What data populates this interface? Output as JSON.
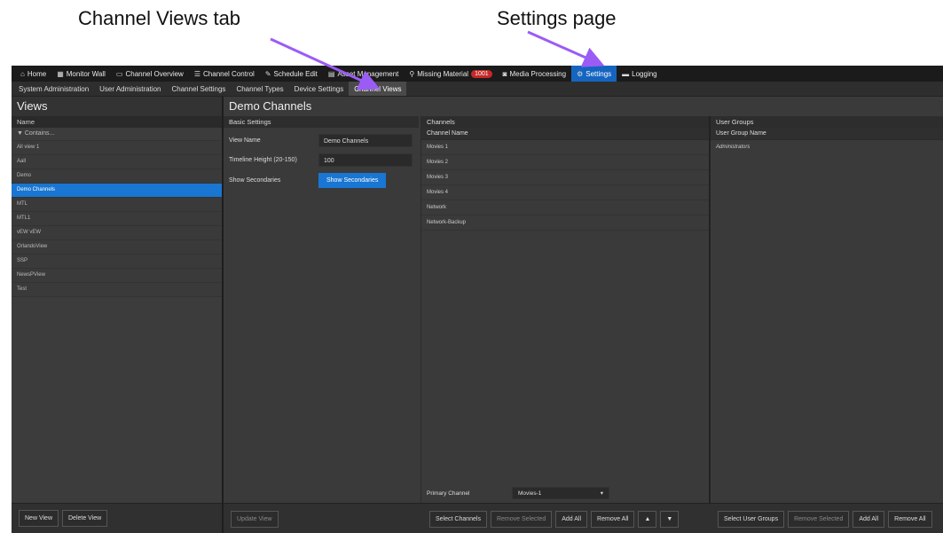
{
  "callouts": {
    "channel_views_tab": "Channel Views tab",
    "settings_page": "Settings page"
  },
  "top_nav": [
    {
      "icon": "home-icon",
      "glyph": "⌂",
      "label": "Home"
    },
    {
      "icon": "monitor-wall-icon",
      "glyph": "▦",
      "label": "Monitor Wall"
    },
    {
      "icon": "channel-overview-icon",
      "glyph": "▭",
      "label": "Channel Overview"
    },
    {
      "icon": "channel-control-icon",
      "glyph": "☰",
      "label": "Channel Control"
    },
    {
      "icon": "schedule-edit-icon",
      "glyph": "✎",
      "label": "Schedule Edit"
    },
    {
      "icon": "asset-management-icon",
      "glyph": "▤",
      "label": "Asset Management"
    },
    {
      "icon": "search-icon",
      "glyph": "⚲",
      "label": "Missing Material",
      "badge": "1001"
    },
    {
      "icon": "media-processing-icon",
      "glyph": "◙",
      "label": "Media Processing"
    },
    {
      "icon": "gear-icon",
      "glyph": "⚙",
      "label": "Settings",
      "active": true
    },
    {
      "icon": "logging-icon",
      "glyph": "▬",
      "label": "Logging"
    }
  ],
  "sub_nav": [
    {
      "label": "System Administration"
    },
    {
      "label": "User Administration"
    },
    {
      "label": "Channel Settings"
    },
    {
      "label": "Channel Types"
    },
    {
      "label": "Device Settings"
    },
    {
      "label": "Channel Views",
      "active": true
    }
  ],
  "views_panel": {
    "title": "Views",
    "column_header": "Name",
    "filter_label": "▼ Contains...",
    "items": [
      "All view 1",
      "Aall",
      "Demo",
      "Demo Channels",
      "MTL",
      "MTL1",
      "vEW vEW",
      "OrlandoView",
      "SSP",
      "NewsPView",
      "Test"
    ],
    "selected_index": 3,
    "new_button": "New View",
    "delete_button": "Delete View"
  },
  "main_panel": {
    "title": "Demo Channels",
    "basic_settings": {
      "header": "Basic Settings",
      "view_name_label": "View Name",
      "view_name_value": "Demo Channels",
      "timeline_label": "Timeline Height (20-150)",
      "timeline_value": "100",
      "show_secondaries_label": "Show Secondaries",
      "show_secondaries_button": "Show Secondaries"
    },
    "channels": {
      "header": "Channels",
      "column_header": "Channel Name",
      "items": [
        "Movies 1",
        "Movies 2",
        "Movies 3",
        "Movies 4",
        "Network",
        "Network-Backup"
      ],
      "primary_label": "Primary Channel",
      "primary_value": "Movies-1",
      "primary_caret": "▾"
    },
    "user_groups": {
      "header": "User Groups",
      "column_header": "User Group Name",
      "items": [
        "Administrators"
      ]
    },
    "buttons": {
      "update_view": "Update View",
      "select_channels": "Select Channels",
      "remove_selected": "Remove Selected",
      "add_all": "Add All",
      "remove_all": "Remove All",
      "move_up": "▲",
      "move_down": "▼",
      "select_user_groups": "Select User Groups",
      "ug_remove_selected": "Remove Selected",
      "ug_add_all": "Add All",
      "ug_remove_all": "Remove All"
    }
  },
  "colors": {
    "accent": "#1976d2",
    "badge": "#c62828",
    "arrow": "#9b5cf6"
  }
}
